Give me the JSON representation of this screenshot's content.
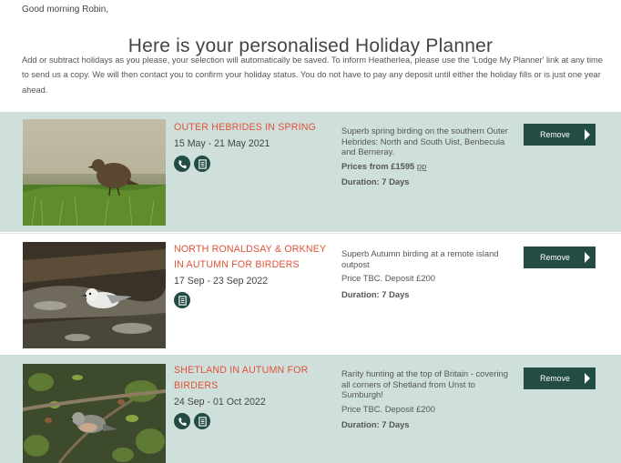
{
  "greeting": "Good morning Robin,",
  "page_title": "Here is your personalised Holiday Planner",
  "intro": "Add or subtract holidays as you please, your selection will automatically be saved. To inform Heatherlea, please use the 'Lodge My Planner' link at any time to send us a copy. We will then contact you to confirm your holiday status. You do not have to pay any deposit until either the holiday fills or is just one year ahead.",
  "holidays": [
    {
      "title": "OUTER HEBRIDES IN SPRING",
      "dates": "15 May - 21 May 2021",
      "icons": [
        "phone-icon",
        "brochure-icon"
      ],
      "description": "Superb spring birding on the southern Outer Hebrides: North and South Uist, Benbecula and Berneray.",
      "price_label": "Prices from",
      "price_value": "£1595",
      "price_suffix": "pp",
      "duration_label": "Duration:",
      "duration_value": "7 Days",
      "button": "Remove"
    },
    {
      "title": "NORTH RONALDSAY & ORKNEY IN AUTUMN FOR BIRDERS",
      "dates": "17 Sep - 23 Sep 2022",
      "icons": [
        "brochure-icon"
      ],
      "description": "Superb Autumn birding at a remote island outpost",
      "price_text": "Price TBC. Deposit £200",
      "duration_label": "Duration:",
      "duration_value": "7 Days",
      "button": "Remove"
    },
    {
      "title": "SHETLAND IN AUTUMN FOR BIRDERS",
      "dates": "24 Sep - 01 Oct 2022",
      "icons": [
        "phone-icon",
        "brochure-icon"
      ],
      "description": "Rarity hunting at the top of Britain - covering all corners of Shetland from Unst to Sumburgh!",
      "price_text": "Price TBC. Deposit £200",
      "duration_label": "Duration:",
      "duration_value": "7 Days",
      "button": "Remove"
    }
  ],
  "colors": {
    "accent_title": "#e0523a",
    "button_bg": "#234c43",
    "card_tint": "#cfe0dc"
  }
}
